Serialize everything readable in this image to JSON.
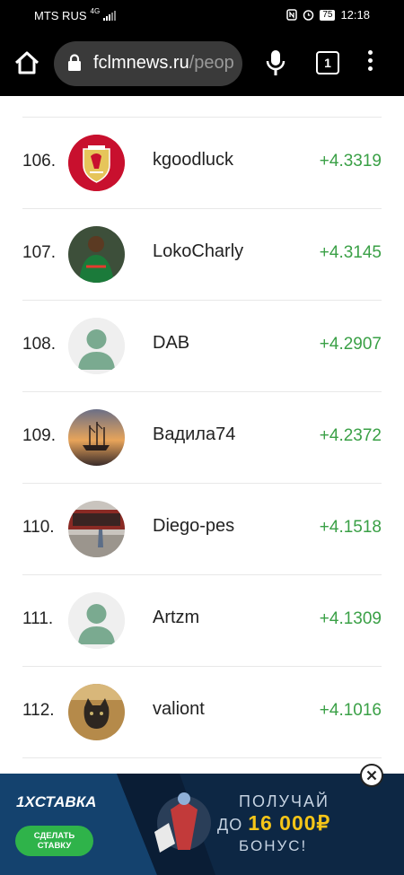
{
  "status_bar": {
    "carrier": "MTS RUS",
    "network": "4G",
    "battery": "75",
    "time": "12:18"
  },
  "browser": {
    "url_main": "fclmnews.ru",
    "url_rest": "/peop",
    "tab_count": "1"
  },
  "rows": [
    {
      "rank": "106.",
      "name": "kgoodluck",
      "score": "+4.3319",
      "avatar": "liverpool-crest"
    },
    {
      "rank": "107.",
      "name": "LokoCharly",
      "score": "+4.3145",
      "avatar": "player-photo"
    },
    {
      "rank": "108.",
      "name": "DAB",
      "score": "+4.2907",
      "avatar": "default-user"
    },
    {
      "rank": "109.",
      "name": "Вадила74",
      "score": "+4.2372",
      "avatar": "sunset-ship"
    },
    {
      "rank": "110.",
      "name": "Diego-pes",
      "score": "+4.1518",
      "avatar": "stadium-photo"
    },
    {
      "rank": "111.",
      "name": "Artzm",
      "score": "+4.1309",
      "avatar": "default-user"
    },
    {
      "rank": "112.",
      "name": "valiont",
      "score": "+4.1016",
      "avatar": "cat-photo"
    }
  ],
  "ad": {
    "brand": "1XСТАВКА",
    "cta_line1": "СДЕЛАТЬ",
    "cta_line2": "СТАВКУ",
    "line1": "ПОЛУЧАЙ",
    "line2_prefix": "ДО ",
    "line2_amount": "16 000₽",
    "line3": "БОНУС!"
  },
  "colors": {
    "score_green": "#3aa046",
    "ad_bg": "#0d2744",
    "cta_green": "#2fb34a",
    "bonus_yellow": "#f5c518"
  }
}
